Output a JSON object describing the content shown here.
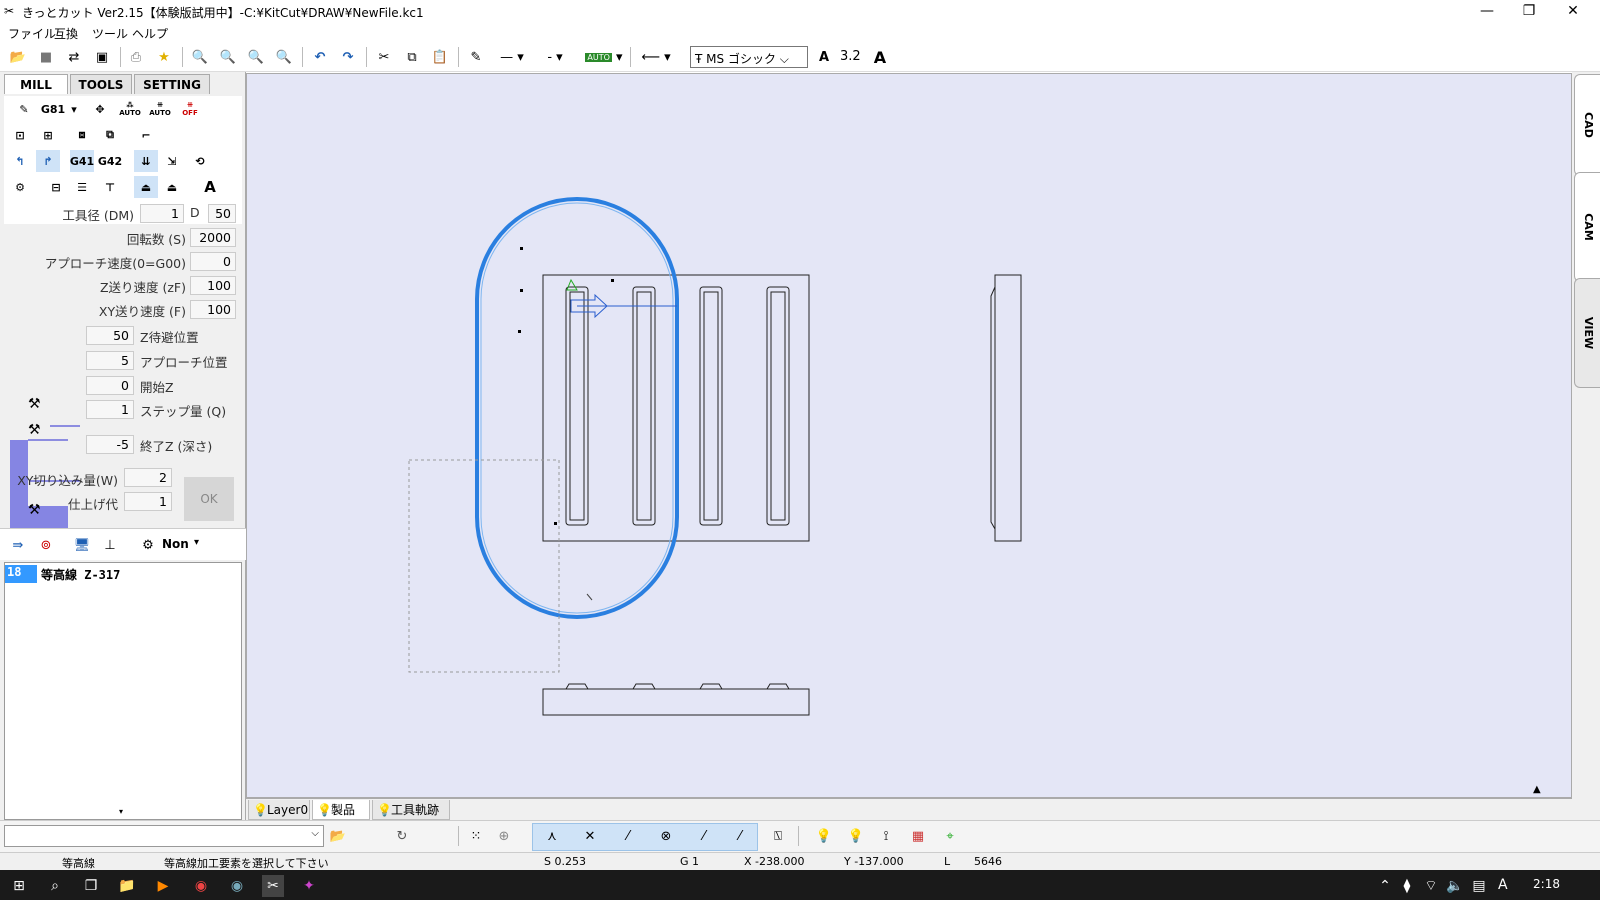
{
  "titlebar": {
    "title": "きっとカット Ver2.15【体験版試用中】-C:¥KitCut¥DRAW¥NewFile.kc1"
  },
  "menubar": {
    "items": [
      "ファイル",
      "互換",
      "ツール",
      "ヘルプ"
    ]
  },
  "toolbar": {
    "font_name": "MS ゴシック",
    "font_size": "3.2",
    "auto_label": "AUTO"
  },
  "left_tabs": [
    "MILL",
    "TOOLS",
    "SETTING"
  ],
  "tool_grid": {
    "g81": "G81",
    "g41": "G41",
    "g42": "G42",
    "auto1": "AUTO",
    "auto2": "AUTO",
    "off": "OFF"
  },
  "params": {
    "tool_dia_label": "工具径 (DM)",
    "tool_dia_value": "1",
    "d_label": "D",
    "d_value": "50",
    "rpm_label": "回転数 (S)",
    "rpm_value": "2000",
    "approach_speed_label": "アプローチ速度(0=G00)",
    "approach_speed_value": "0",
    "z_feed_label": "Z送り速度 (zF)",
    "z_feed_value": "100",
    "xy_feed_label": "XY送り速度 (F)",
    "xy_feed_value": "100",
    "z_safe_value": "50",
    "z_safe_label": "Z待避位置",
    "approach_pos_value": "5",
    "approach_pos_label": "アプローチ位置",
    "start_z_value": "0",
    "start_z_label": "開始Z",
    "step_value": "1",
    "step_label": "ステップ量 (Q)",
    "end_z_value": "-5",
    "end_z_label": "終了Z (深さ)",
    "xy_cut_label": "XY切り込み量(W)",
    "xy_cut_value": "2",
    "finish_label": "仕上げ代",
    "finish_value": "1",
    "ok_label": "OK"
  },
  "layer_toolbar": {
    "non_label": "Non"
  },
  "operations": [
    {
      "num": "18",
      "name": "等高線 Z-317"
    }
  ],
  "right_tabs": [
    "CAD",
    "CAM",
    "VIEW"
  ],
  "layer_tabs": [
    "Layer0",
    "製品",
    "工具軌跡"
  ],
  "statusbar": {
    "mode": "等高線",
    "message": "等高線加工要素を選択して下さい",
    "s": "S 0.253",
    "g": "G 1",
    "x": "X -238.000",
    "y": "Y -137.000",
    "l_label": "L",
    "l_value": "5646"
  },
  "taskbar": {
    "clock": "2:18",
    "ime": "A"
  }
}
